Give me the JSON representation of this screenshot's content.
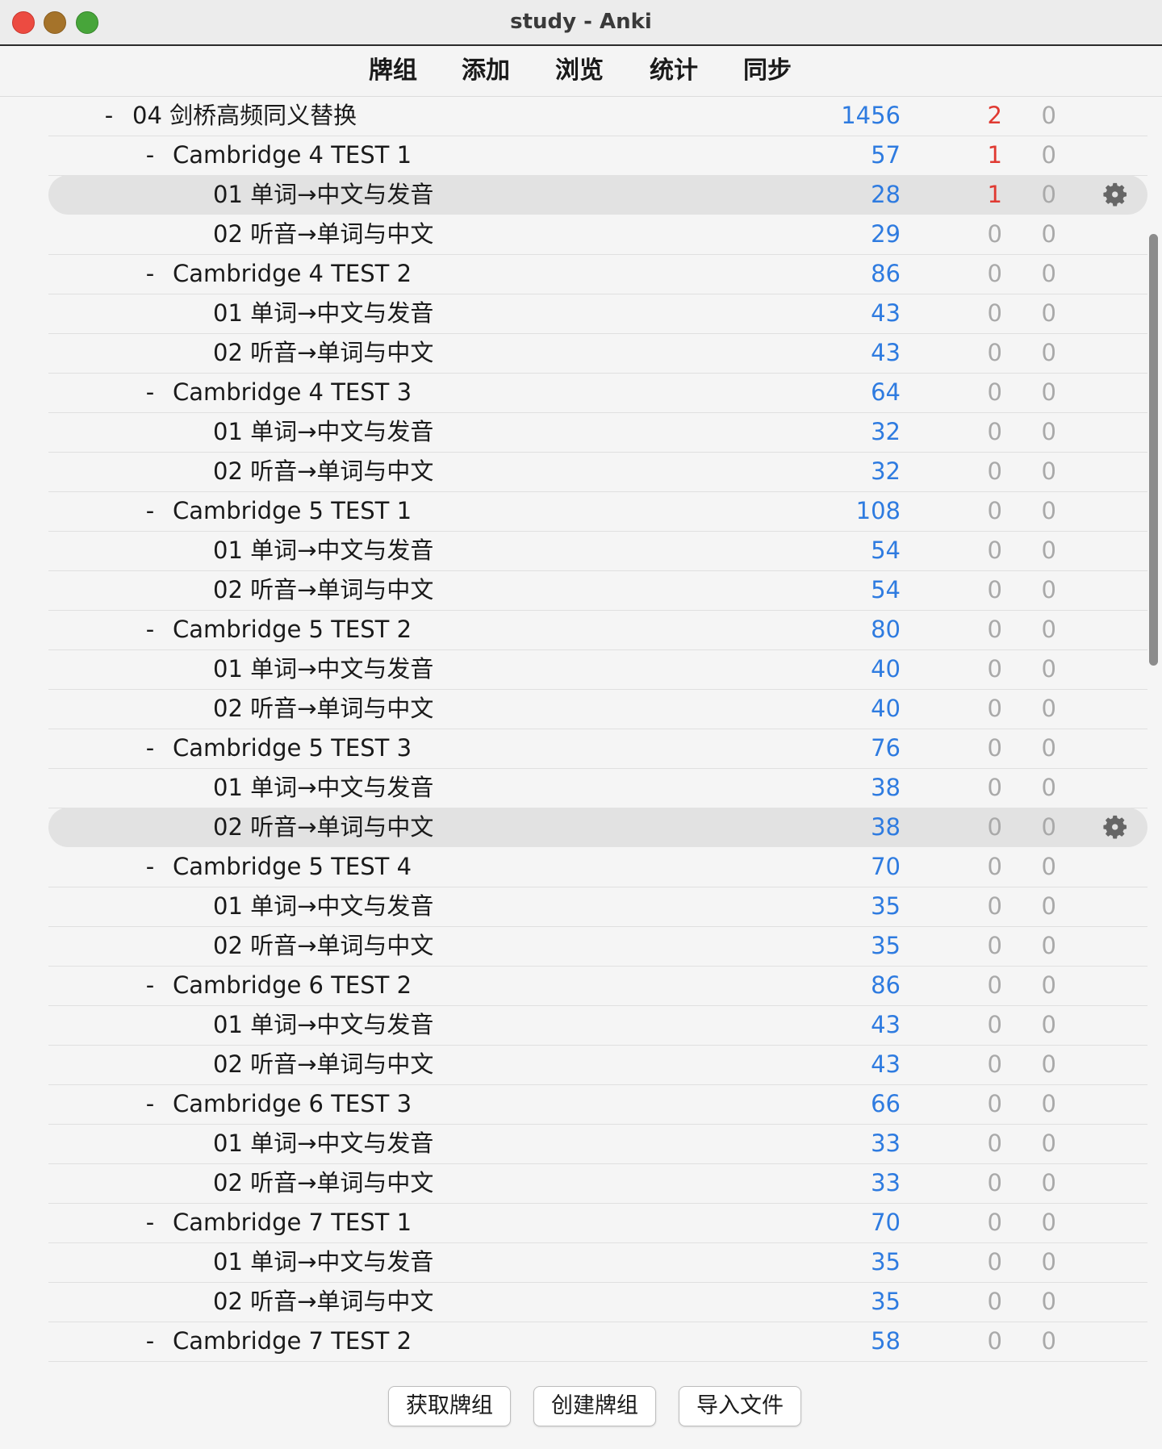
{
  "window": {
    "title": "study - Anki"
  },
  "toolbar": {
    "items": [
      "牌组",
      "添加",
      "浏览",
      "统计",
      "同步"
    ]
  },
  "decks": [
    {
      "expander": "-",
      "name": "04 剑桥高频同义替换",
      "level": 0,
      "due": "1456",
      "new": "2",
      "learn": "0",
      "new_red": true
    },
    {
      "expander": "-",
      "name": "Cambridge 4 TEST 1",
      "level": 1,
      "due": "57",
      "new": "1",
      "learn": "0",
      "new_red": true
    },
    {
      "expander": "",
      "name": "01 单词→中文与发音",
      "level": 2,
      "due": "28",
      "new": "1",
      "learn": "0",
      "new_red": true,
      "current": true
    },
    {
      "expander": "",
      "name": "02 听音→单词与中文",
      "level": 2,
      "due": "29",
      "new": "0",
      "learn": "0"
    },
    {
      "expander": "-",
      "name": "Cambridge 4 TEST 2",
      "level": 1,
      "due": "86",
      "new": "0",
      "learn": "0"
    },
    {
      "expander": "",
      "name": "01 单词→中文与发音",
      "level": 2,
      "due": "43",
      "new": "0",
      "learn": "0"
    },
    {
      "expander": "",
      "name": "02 听音→单词与中文",
      "level": 2,
      "due": "43",
      "new": "0",
      "learn": "0"
    },
    {
      "expander": "-",
      "name": "Cambridge 4 TEST 3",
      "level": 1,
      "due": "64",
      "new": "0",
      "learn": "0"
    },
    {
      "expander": "",
      "name": "01 单词→中文与发音",
      "level": 2,
      "due": "32",
      "new": "0",
      "learn": "0"
    },
    {
      "expander": "",
      "name": "02 听音→单词与中文",
      "level": 2,
      "due": "32",
      "new": "0",
      "learn": "0"
    },
    {
      "expander": "-",
      "name": "Cambridge 5 TEST 1",
      "level": 1,
      "due": "108",
      "new": "0",
      "learn": "0"
    },
    {
      "expander": "",
      "name": "01 单词→中文与发音",
      "level": 2,
      "due": "54",
      "new": "0",
      "learn": "0"
    },
    {
      "expander": "",
      "name": "02 听音→单词与中文",
      "level": 2,
      "due": "54",
      "new": "0",
      "learn": "0"
    },
    {
      "expander": "-",
      "name": "Cambridge 5 TEST 2",
      "level": 1,
      "due": "80",
      "new": "0",
      "learn": "0"
    },
    {
      "expander": "",
      "name": "01 单词→中文与发音",
      "level": 2,
      "due": "40",
      "new": "0",
      "learn": "0"
    },
    {
      "expander": "",
      "name": "02 听音→单词与中文",
      "level": 2,
      "due": "40",
      "new": "0",
      "learn": "0"
    },
    {
      "expander": "-",
      "name": "Cambridge 5 TEST 3",
      "level": 1,
      "due": "76",
      "new": "0",
      "learn": "0"
    },
    {
      "expander": "",
      "name": "01 单词→中文与发音",
      "level": 2,
      "due": "38",
      "new": "0",
      "learn": "0"
    },
    {
      "expander": "",
      "name": "02 听音→单词与中文",
      "level": 2,
      "due": "38",
      "new": "0",
      "learn": "0",
      "current": true
    },
    {
      "expander": "-",
      "name": "Cambridge 5 TEST 4",
      "level": 1,
      "due": "70",
      "new": "0",
      "learn": "0"
    },
    {
      "expander": "",
      "name": "01 单词→中文与发音",
      "level": 2,
      "due": "35",
      "new": "0",
      "learn": "0"
    },
    {
      "expander": "",
      "name": "02 听音→单词与中文",
      "level": 2,
      "due": "35",
      "new": "0",
      "learn": "0"
    },
    {
      "expander": "-",
      "name": "Cambridge 6 TEST 2",
      "level": 1,
      "due": "86",
      "new": "0",
      "learn": "0"
    },
    {
      "expander": "",
      "name": "01 单词→中文与发音",
      "level": 2,
      "due": "43",
      "new": "0",
      "learn": "0"
    },
    {
      "expander": "",
      "name": "02 听音→单词与中文",
      "level": 2,
      "due": "43",
      "new": "0",
      "learn": "0"
    },
    {
      "expander": "-",
      "name": "Cambridge 6 TEST 3",
      "level": 1,
      "due": "66",
      "new": "0",
      "learn": "0"
    },
    {
      "expander": "",
      "name": "01 单词→中文与发音",
      "level": 2,
      "due": "33",
      "new": "0",
      "learn": "0"
    },
    {
      "expander": "",
      "name": "02 听音→单词与中文",
      "level": 2,
      "due": "33",
      "new": "0",
      "learn": "0"
    },
    {
      "expander": "-",
      "name": "Cambridge 7 TEST 1",
      "level": 1,
      "due": "70",
      "new": "0",
      "learn": "0"
    },
    {
      "expander": "",
      "name": "01 单词→中文与发音",
      "level": 2,
      "due": "35",
      "new": "0",
      "learn": "0"
    },
    {
      "expander": "",
      "name": "02 听音→单词与中文",
      "level": 2,
      "due": "35",
      "new": "0",
      "learn": "0"
    },
    {
      "expander": "-",
      "name": "Cambridge 7 TEST 2",
      "level": 1,
      "due": "58",
      "new": "0",
      "learn": "0"
    }
  ],
  "bottom_buttons": {
    "get_shared": "获取牌组",
    "create_deck": "创建牌组",
    "import_file": "导入文件"
  },
  "colors": {
    "due": "#2e7be0",
    "new_highlight": "#e03a32",
    "zero": "#a9a9a9"
  },
  "icons": {
    "deck_options": "gear-icon"
  }
}
